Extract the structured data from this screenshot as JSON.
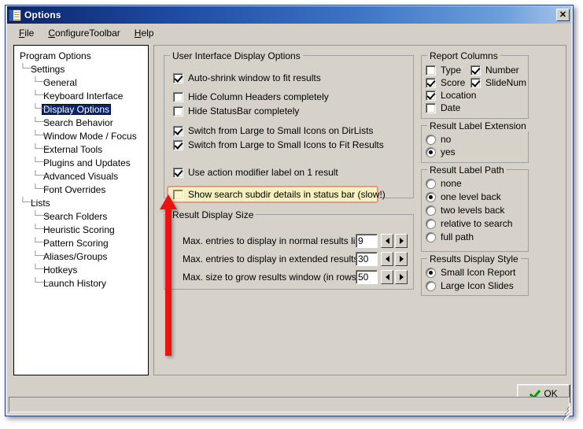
{
  "window": {
    "title": "Options",
    "icon": "options-checklist-icon",
    "close_label": "✕"
  },
  "menubar": {
    "items": [
      {
        "id": "file",
        "label": "File",
        "accel": "F"
      },
      {
        "id": "configure-toolbar",
        "label": "ConfigureToolbar",
        "accel": "C"
      },
      {
        "id": "help",
        "label": "Help",
        "accel": "H"
      }
    ]
  },
  "tree": {
    "items": [
      {
        "label": "Program Options",
        "level": 1,
        "selected": false
      },
      {
        "label": "Settings",
        "level": 2,
        "selected": false
      },
      {
        "label": "General",
        "level": 3,
        "selected": false
      },
      {
        "label": "Keyboard Interface",
        "level": 3,
        "selected": false
      },
      {
        "label": "Display Options",
        "level": 3,
        "selected": true
      },
      {
        "label": "Search Behavior",
        "level": 3,
        "selected": false
      },
      {
        "label": "Window Mode / Focus",
        "level": 3,
        "selected": false
      },
      {
        "label": "External Tools",
        "level": 3,
        "selected": false
      },
      {
        "label": "Plugins and Updates",
        "level": 3,
        "selected": false
      },
      {
        "label": "Advanced Visuals",
        "level": 3,
        "selected": false
      },
      {
        "label": "Font Overrides",
        "level": 3,
        "selected": false
      },
      {
        "label": "Lists",
        "level": 2,
        "selected": false
      },
      {
        "label": "Search Folders",
        "level": 3,
        "selected": false
      },
      {
        "label": "Heuristic Scoring",
        "level": 3,
        "selected": false
      },
      {
        "label": "Pattern Scoring",
        "level": 3,
        "selected": false
      },
      {
        "label": "Aliases/Groups",
        "level": 3,
        "selected": false
      },
      {
        "label": "Hotkeys",
        "level": 3,
        "selected": false
      },
      {
        "label": "Launch History",
        "level": 3,
        "selected": false
      }
    ]
  },
  "ui_display_options": {
    "title": "User Interface Display Options",
    "checkboxes": [
      {
        "id": "auto-shrink",
        "label": "Auto-shrink window to fit results",
        "checked": true,
        "highlighted": false
      },
      {
        "id": "hide-column-headers",
        "label": "Hide Column Headers completely",
        "checked": false,
        "highlighted": false
      },
      {
        "id": "hide-statusbar",
        "label": "Hide StatusBar completely",
        "checked": false,
        "highlighted": false
      },
      {
        "id": "switch-small-icons-dirlists",
        "label": "Switch from Large to Small Icons on DirLists",
        "checked": true,
        "highlighted": false
      },
      {
        "id": "switch-small-icons-fit-results",
        "label": "Switch from Large to Small Icons to Fit Results",
        "checked": true,
        "highlighted": false
      },
      {
        "id": "use-action-modifier-label",
        "label": "Use action modifier label on 1 result",
        "checked": true,
        "highlighted": false
      },
      {
        "id": "show-search-subdir-details",
        "label": "Show search subdir details in status bar (slow!)",
        "checked": false,
        "highlighted": true
      }
    ]
  },
  "result_display_size": {
    "title": "Result Display Size",
    "rows": [
      {
        "id": "max-entries-normal",
        "label": "Max. entries to display in normal results list:",
        "value": "9"
      },
      {
        "id": "max-entries-extended",
        "label": "Max. entries to display in extended results list:",
        "value": "30"
      },
      {
        "id": "max-grow-rows",
        "label": "Max. size to grow results window (in rows):",
        "value": "50"
      }
    ],
    "spin_down_icon": "triangle-left-icon",
    "spin_up_icon": "triangle-right-icon"
  },
  "report_columns": {
    "title": "Report Columns",
    "items": [
      {
        "id": "type",
        "label": "Type",
        "checked": false,
        "col": 0,
        "row": 0
      },
      {
        "id": "number",
        "label": "Number",
        "checked": true,
        "col": 1,
        "row": 0
      },
      {
        "id": "score",
        "label": "Score",
        "checked": true,
        "col": 0,
        "row": 1
      },
      {
        "id": "slidenum",
        "label": "SlideNum",
        "checked": true,
        "col": 1,
        "row": 1
      },
      {
        "id": "location",
        "label": "Location",
        "checked": true,
        "col": 0,
        "row": 2
      },
      {
        "id": "date",
        "label": "Date",
        "checked": false,
        "col": 0,
        "row": 3
      }
    ]
  },
  "result_label_extension": {
    "title": "Result Label Extension",
    "options": [
      {
        "id": "no",
        "label": "no",
        "selected": false
      },
      {
        "id": "yes",
        "label": "yes",
        "selected": true
      }
    ]
  },
  "result_label_path": {
    "title": "Result Label Path",
    "options": [
      {
        "id": "none",
        "label": "none",
        "selected": false
      },
      {
        "id": "one-level-back",
        "label": "one level back",
        "selected": true
      },
      {
        "id": "two-levels-back",
        "label": "two levels back",
        "selected": false
      },
      {
        "id": "relative-to-search",
        "label": "relative to search",
        "selected": false
      },
      {
        "id": "full-path",
        "label": "full path",
        "selected": false
      }
    ]
  },
  "results_display_style": {
    "title": "Results Display Style",
    "options": [
      {
        "id": "small-icon-report",
        "label": "Small Icon Report",
        "selected": true
      },
      {
        "id": "large-icon-slides",
        "label": "Large Icon Slides",
        "selected": false
      }
    ]
  },
  "footer": {
    "ok_label": "OK",
    "ok_accel": "O",
    "ok_icon": "green-check-icon"
  },
  "annotation": {
    "arrow_color": "#ee1111",
    "highlight_fill": "#f6f0bf",
    "highlight_border": "#e09a8c",
    "points_to": "show-search-subdir-details"
  }
}
